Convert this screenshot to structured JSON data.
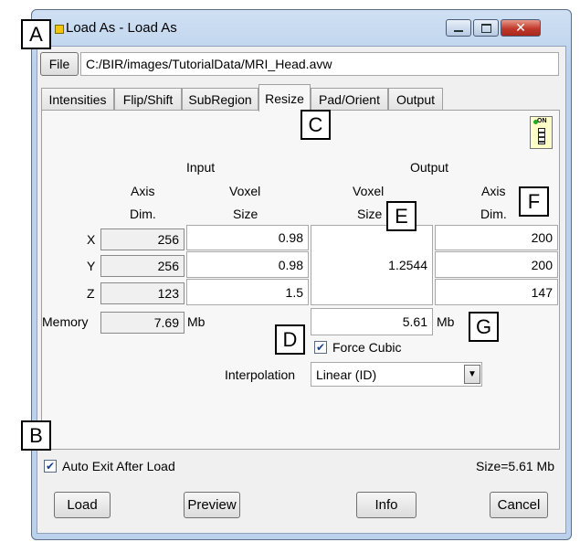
{
  "window": {
    "title": "Load As - Load As"
  },
  "file": {
    "button": "File",
    "path": "C:/BIR/images/TutorialData/MRI_Head.avw"
  },
  "tabs": [
    "Intensities",
    "Flip/Shift",
    "SubRegion",
    "Resize",
    "Pad/Orient",
    "Output"
  ],
  "active_tab": "Resize",
  "resize": {
    "input_header": "Input",
    "output_header": "Output",
    "axis_dim": [
      "Axis",
      "Dim."
    ],
    "voxel_size": [
      "Voxel",
      "Size"
    ],
    "rows": [
      {
        "axis": "X",
        "in_dim": "256",
        "in_voxel": "0.98",
        "out_dim": "200"
      },
      {
        "axis": "Y",
        "in_dim": "256",
        "in_voxel": "0.98",
        "out_dim": "200"
      },
      {
        "axis": "Z",
        "in_dim": "123",
        "in_voxel": "1.5",
        "out_dim": "147"
      }
    ],
    "out_voxel": "1.2544",
    "memory_label": "Memory",
    "memory_in": "7.69",
    "memory_out": "5.61",
    "unit": "Mb",
    "force_cubic_label": "Force Cubic",
    "interpolation_label": "Interpolation",
    "interpolation_value": "Linear (ID)",
    "on_icon_text": "ON"
  },
  "footer": {
    "auto_exit_label": "Auto Exit After Load",
    "size_text": "Size=5.61 Mb",
    "buttons": {
      "load": "Load",
      "preview": "Preview",
      "info": "Info",
      "cancel": "Cancel"
    }
  },
  "callouts": [
    "A",
    "B",
    "C",
    "D",
    "E",
    "F",
    "G"
  ],
  "colors": {
    "title_bg": "#bcd2ec",
    "close_button": "#c0392b",
    "face": "#f0f0f0",
    "check": "#1b3d8f"
  }
}
